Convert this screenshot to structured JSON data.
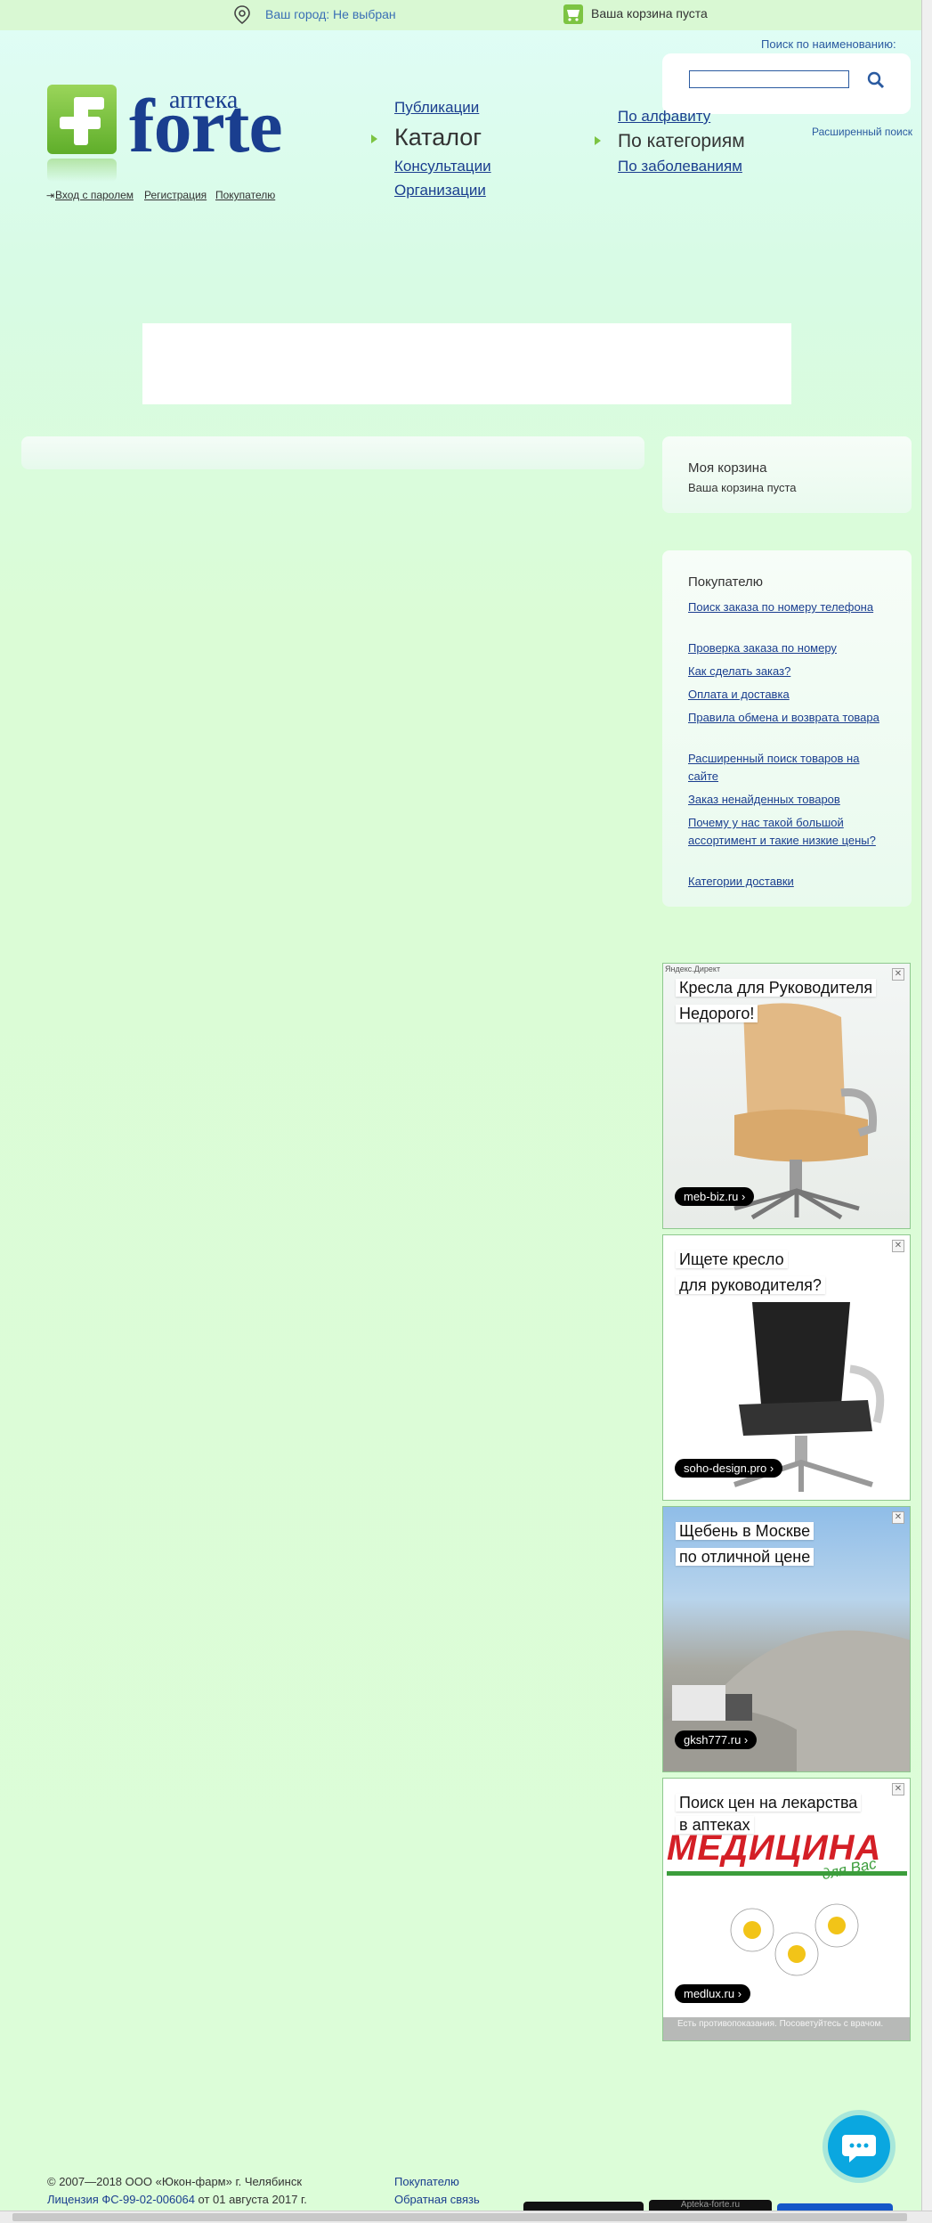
{
  "topbar": {
    "city_prefix": "Ваш город:",
    "city_value": "Не выбран",
    "cart_status": "Ваша корзина пуста"
  },
  "search": {
    "label": "Поиск по наименованию:",
    "input_value": "",
    "advanced_link": "Расширенный поиск"
  },
  "logo": {
    "small": "аптека",
    "big": "forte"
  },
  "auth": {
    "login": "Вход с паролем",
    "register": "Регистрация",
    "buyer": "Покупателю"
  },
  "nav": {
    "publications": "Публикации",
    "catalog": "Каталог",
    "consultations": "Консультации",
    "organizations": "Организации",
    "alphabet": "По алфавиту",
    "categories": "По категориям",
    "diseases": "По заболеваниям"
  },
  "cart_panel": {
    "title": "Моя корзина",
    "status": "Ваша корзина пуста"
  },
  "buyer_panel": {
    "title": "Покупателю",
    "links": [
      "Поиск заказа по номеру телефона",
      "Проверка заказа по номеру",
      "Как сделать заказ?",
      "Оплата и доставка",
      "Правила обмена и возврата товара",
      "Расширенный поиск товаров на сайте",
      "Заказ ненайденных товаров",
      "Почему у нас такой большой ассортимент и такие низкие цены?",
      "Категории доставки"
    ]
  },
  "ads": {
    "label": "Яндекс.Директ",
    "items": [
      {
        "title1": "Кресла для Руководителя",
        "title2": "Недорого!",
        "domain": "meb-biz.ru ›"
      },
      {
        "title1": "Ищете кресло",
        "title2": "для руководителя?",
        "domain": "soho-design.pro ›"
      },
      {
        "title1": "Щебень в Москве",
        "title2": "по отличной цене",
        "domain": "gksh777.ru ›"
      },
      {
        "title1": "Поиск цен на лекарства",
        "title2": "в аптеках",
        "domain": "medlux.ru ›",
        "logo_text": "МЕДИЦИНА",
        "logo_sub": "для Вас",
        "warning": "Есть противопоказания. Посоветуйтесь с врачом."
      }
    ]
  },
  "footer": {
    "copyright": "© 2007—2018  ООО «Юкон-фарм» г. Челябинск",
    "license_link": "Лицензия ФС-99-02-006064",
    "license_date": " от 01 августа 2017 г.",
    "buyer_link": "Покупателю",
    "feedback_link": "Обратная связь",
    "bottom_badge": "Apteka-forte.ru"
  },
  "colors": {
    "accent_green": "#7cc442",
    "link_blue": "#1a3e8f",
    "chat_blue": "#0aa7e0"
  }
}
